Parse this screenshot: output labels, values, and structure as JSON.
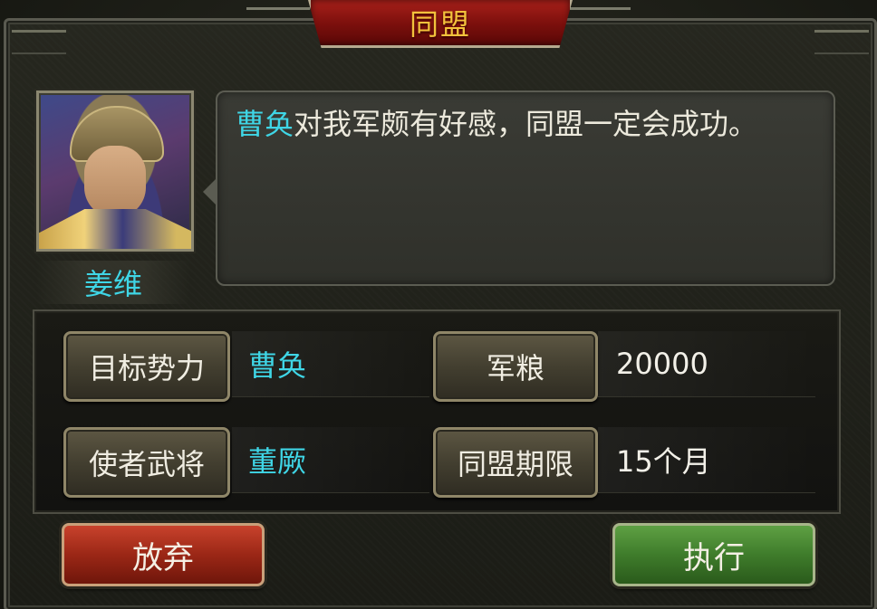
{
  "dialog": {
    "title": "同盟"
  },
  "advisor": {
    "name": "姜维",
    "message_highlight": "曹奂",
    "message_rest": "对我军颇有好感，同盟一定会成功。"
  },
  "fields": {
    "target_label": "目标势力",
    "target_value": "曹奂",
    "provisions_label": "军粮",
    "provisions_value": "20000",
    "envoy_label": "使者武将",
    "envoy_value": "董厥",
    "duration_label": "同盟期限",
    "duration_value": "15个月"
  },
  "actions": {
    "abandon_label": "放弃",
    "execute_label": "执行"
  },
  "colors": {
    "highlight": "#3fd6e6",
    "title": "#f3c23c",
    "abandon": "#9b2716",
    "execute": "#3f7c2b"
  }
}
